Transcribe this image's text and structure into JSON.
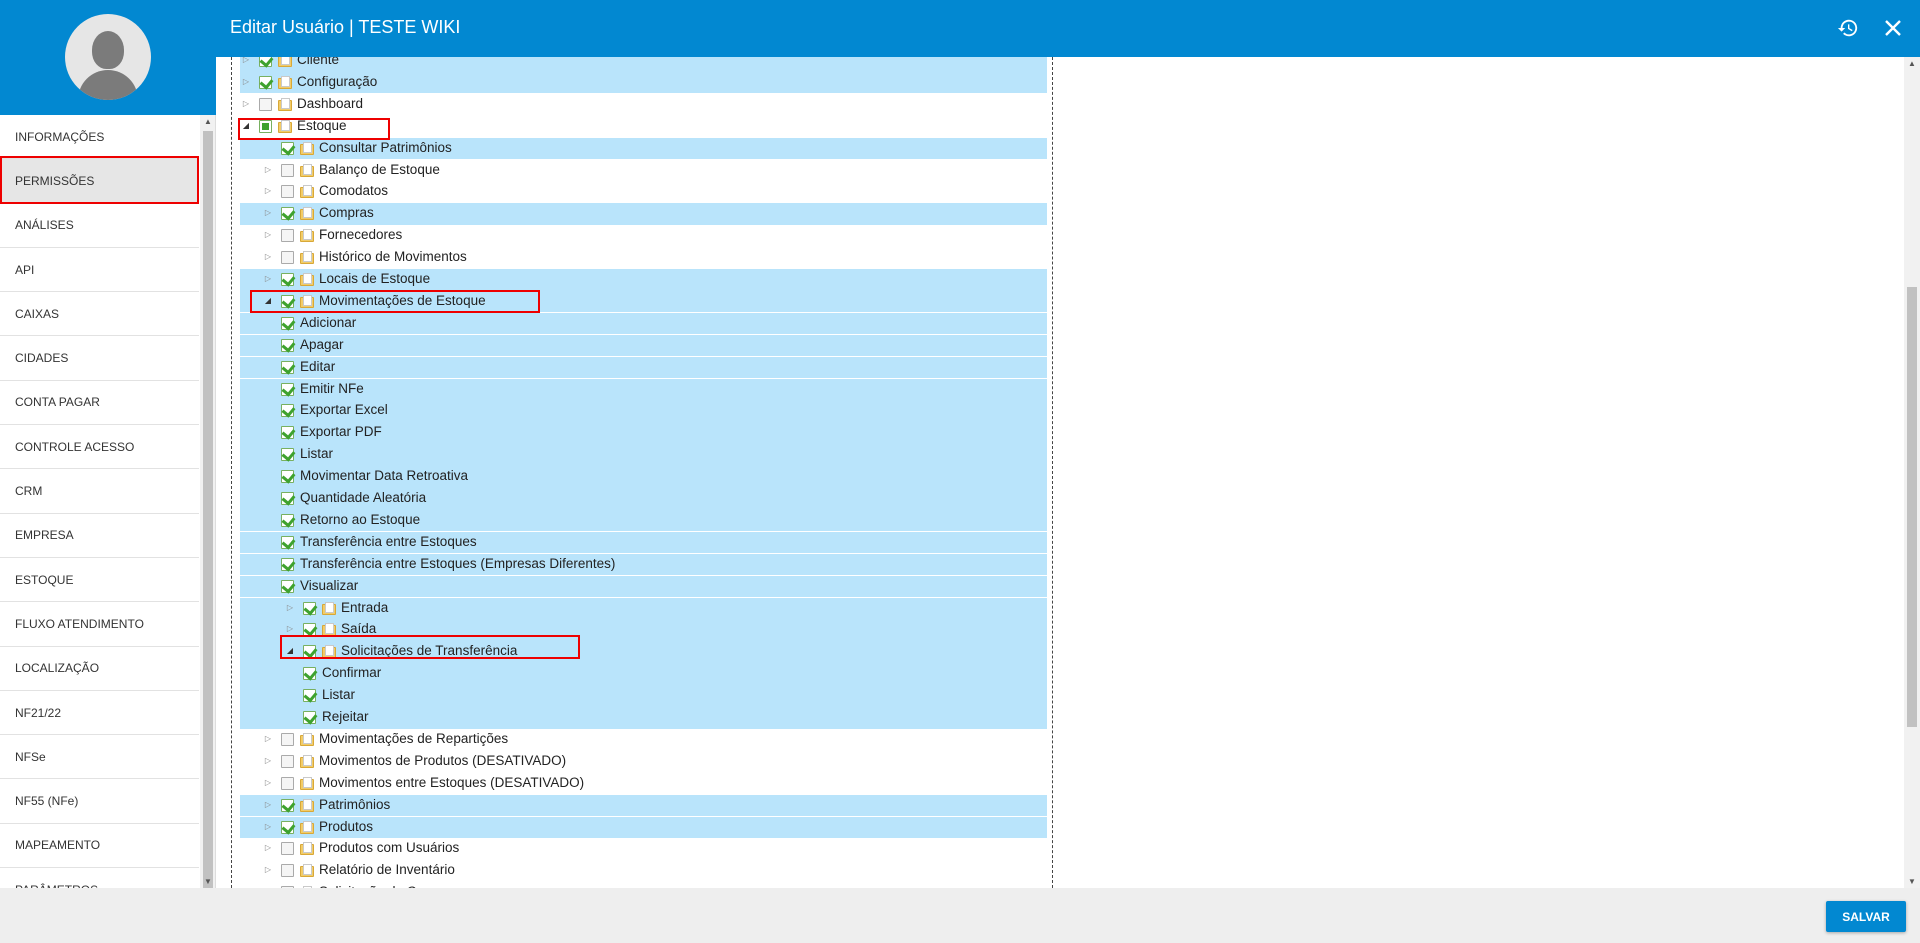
{
  "header": {
    "title": "Editar Usuário | TESTE WIKI",
    "icons": [
      "history-icon",
      "close-icon"
    ],
    "color": "#0288d1"
  },
  "sidebar": {
    "items": [
      {
        "label": "INFORMAÇÕES"
      },
      {
        "label": "PERMISSÕES",
        "active": true
      },
      {
        "label": "ANÁLISES"
      },
      {
        "label": "API"
      },
      {
        "label": "CAIXAS"
      },
      {
        "label": "CIDADES"
      },
      {
        "label": "CONTA PAGAR"
      },
      {
        "label": "CONTROLE ACESSO"
      },
      {
        "label": "CRM"
      },
      {
        "label": "EMPRESA"
      },
      {
        "label": "ESTOQUE"
      },
      {
        "label": "FLUXO ATENDIMENTO"
      },
      {
        "label": "LOCALIZAÇÃO"
      },
      {
        "label": "NF21/22"
      },
      {
        "label": "NFSe"
      },
      {
        "label": "NF55 (NFe)"
      },
      {
        "label": "MAPEAMENTO"
      },
      {
        "label": "PARÂMETROS"
      }
    ]
  },
  "tree": {
    "rows": [
      {
        "label": "Cliente",
        "level": 0,
        "state": "checked",
        "expander": "closed",
        "folder": true
      },
      {
        "label": "Configuração",
        "level": 0,
        "state": "checked",
        "expander": "closed",
        "folder": true
      },
      {
        "label": "Dashboard",
        "level": 0,
        "state": "unchecked",
        "expander": "closed",
        "folder": true
      },
      {
        "label": "Estoque",
        "level": 0,
        "state": "partial",
        "expander": "open",
        "folder": true
      },
      {
        "label": "Consultar Patrimônios",
        "level": 1,
        "state": "checked",
        "expander": "none",
        "folder": true
      },
      {
        "label": "Balanço de Estoque",
        "level": 1,
        "state": "unchecked",
        "expander": "closed",
        "folder": true
      },
      {
        "label": "Comodatos",
        "level": 1,
        "state": "unchecked",
        "expander": "closed",
        "folder": true
      },
      {
        "label": "Compras",
        "level": 1,
        "state": "checked",
        "expander": "closed",
        "folder": true
      },
      {
        "label": "Fornecedores",
        "level": 1,
        "state": "unchecked",
        "expander": "closed",
        "folder": true
      },
      {
        "label": "Histórico de Movimentos",
        "level": 1,
        "state": "unchecked",
        "expander": "closed",
        "folder": true
      },
      {
        "label": "Locais de Estoque",
        "level": 1,
        "state": "checked",
        "expander": "closed",
        "folder": true
      },
      {
        "label": "Movimentações de Estoque",
        "level": 1,
        "state": "checked",
        "expander": "open",
        "folder": true
      },
      {
        "label": "Adicionar",
        "level": 2,
        "state": "checked",
        "expander": "none",
        "folder": false
      },
      {
        "label": "Apagar",
        "level": 2,
        "state": "checked",
        "expander": "none",
        "folder": false
      },
      {
        "label": "Editar",
        "level": 2,
        "state": "checked",
        "expander": "none",
        "folder": false
      },
      {
        "label": "Emitir NFe",
        "level": 2,
        "state": "checked",
        "expander": "none",
        "folder": false
      },
      {
        "label": "Exportar Excel",
        "level": 2,
        "state": "checked",
        "expander": "none",
        "folder": false
      },
      {
        "label": "Exportar PDF",
        "level": 2,
        "state": "checked",
        "expander": "none",
        "folder": false
      },
      {
        "label": "Listar",
        "level": 2,
        "state": "checked",
        "expander": "none",
        "folder": false
      },
      {
        "label": "Movimentar Data Retroativa",
        "level": 2,
        "state": "checked",
        "expander": "none",
        "folder": false
      },
      {
        "label": "Quantidade Aleatória",
        "level": 2,
        "state": "checked",
        "expander": "none",
        "folder": false
      },
      {
        "label": "Retorno ao Estoque",
        "level": 2,
        "state": "checked",
        "expander": "none",
        "folder": false
      },
      {
        "label": "Transferência entre Estoques",
        "level": 2,
        "state": "checked",
        "expander": "none",
        "folder": false
      },
      {
        "label": "Transferência entre Estoques (Empresas Diferentes)",
        "level": 2,
        "state": "checked",
        "expander": "none",
        "folder": false
      },
      {
        "label": "Visualizar",
        "level": 2,
        "state": "checked",
        "expander": "none",
        "folder": false
      },
      {
        "label": "Entrada",
        "level": 2,
        "state": "checked",
        "expander": "closed",
        "folder": true
      },
      {
        "label": "Saída",
        "level": 2,
        "state": "checked",
        "expander": "closed",
        "folder": true
      },
      {
        "label": "Solicitações de Transferência",
        "level": 2,
        "state": "checked",
        "expander": "open",
        "folder": true
      },
      {
        "label": "Confirmar",
        "level": 3,
        "state": "checked",
        "expander": "none",
        "folder": false
      },
      {
        "label": "Listar",
        "level": 3,
        "state": "checked",
        "expander": "none",
        "folder": false
      },
      {
        "label": "Rejeitar",
        "level": 3,
        "state": "checked",
        "expander": "none",
        "folder": false
      },
      {
        "label": "Movimentações de Repartições",
        "level": 1,
        "state": "unchecked",
        "expander": "closed",
        "folder": true
      },
      {
        "label": "Movimentos de Produtos (DESATIVADO)",
        "level": 1,
        "state": "unchecked",
        "expander": "closed",
        "folder": true
      },
      {
        "label": "Movimentos entre Estoques (DESATIVADO)",
        "level": 1,
        "state": "unchecked",
        "expander": "closed",
        "folder": true
      },
      {
        "label": "Patrimônios",
        "level": 1,
        "state": "checked",
        "expander": "closed",
        "folder": true
      },
      {
        "label": "Produtos",
        "level": 1,
        "state": "checked",
        "expander": "closed",
        "folder": true
      },
      {
        "label": "Produtos com Usuários",
        "level": 1,
        "state": "unchecked",
        "expander": "closed",
        "folder": true
      },
      {
        "label": "Relatório de Inventário",
        "level": 1,
        "state": "unchecked",
        "expander": "closed",
        "folder": true
      },
      {
        "label": "Solicitação de Compra",
        "level": 1,
        "state": "unchecked",
        "expander": "closed",
        "folder": true
      }
    ]
  },
  "footer": {
    "save_label": "SALVAR"
  }
}
